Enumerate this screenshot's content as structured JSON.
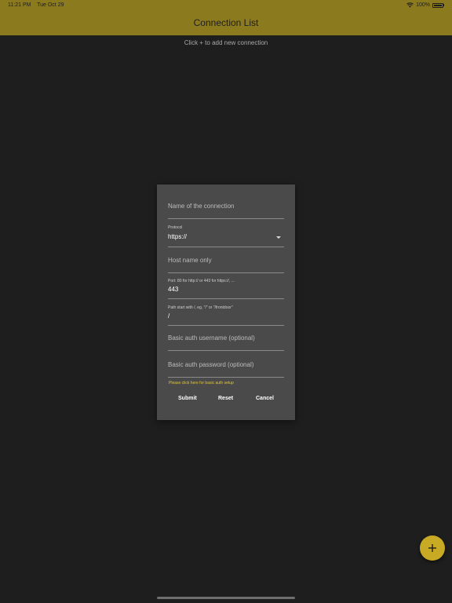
{
  "status_bar": {
    "time": "11:21 PM",
    "date": "Tue Oct 29",
    "battery": "100%"
  },
  "header": {
    "title": "Connection List"
  },
  "hint": "Click + to add new connection",
  "dialog": {
    "name_placeholder": "Name of the connection",
    "protocol_label": "Protocol",
    "protocol_value": "https://",
    "host_placeholder": "Host name only",
    "port_label": "Port: 80 for http:// or 443 for https://, ...",
    "port_value": "443",
    "path_label": "Path start with /, eg, \"/\" or \"/frontdoor\"",
    "path_value": "/",
    "username_placeholder": "Basic auth username (optional)",
    "password_placeholder": "Basic auth password (optional)",
    "auth_link": "Please click here for basic auth setup",
    "submit": "Submit",
    "reset": "Reset",
    "cancel": "Cancel"
  },
  "colors": {
    "accent": "#c9aa25",
    "header_bg": "#8c7a1f",
    "background": "#1e1e1e",
    "dialog_bg": "#4a4a4a",
    "link": "#e0c43a"
  },
  "icons": {
    "fab": "plus-icon",
    "wifi": "wifi-icon",
    "battery": "battery-icon",
    "dropdown": "chevron-down-icon"
  }
}
